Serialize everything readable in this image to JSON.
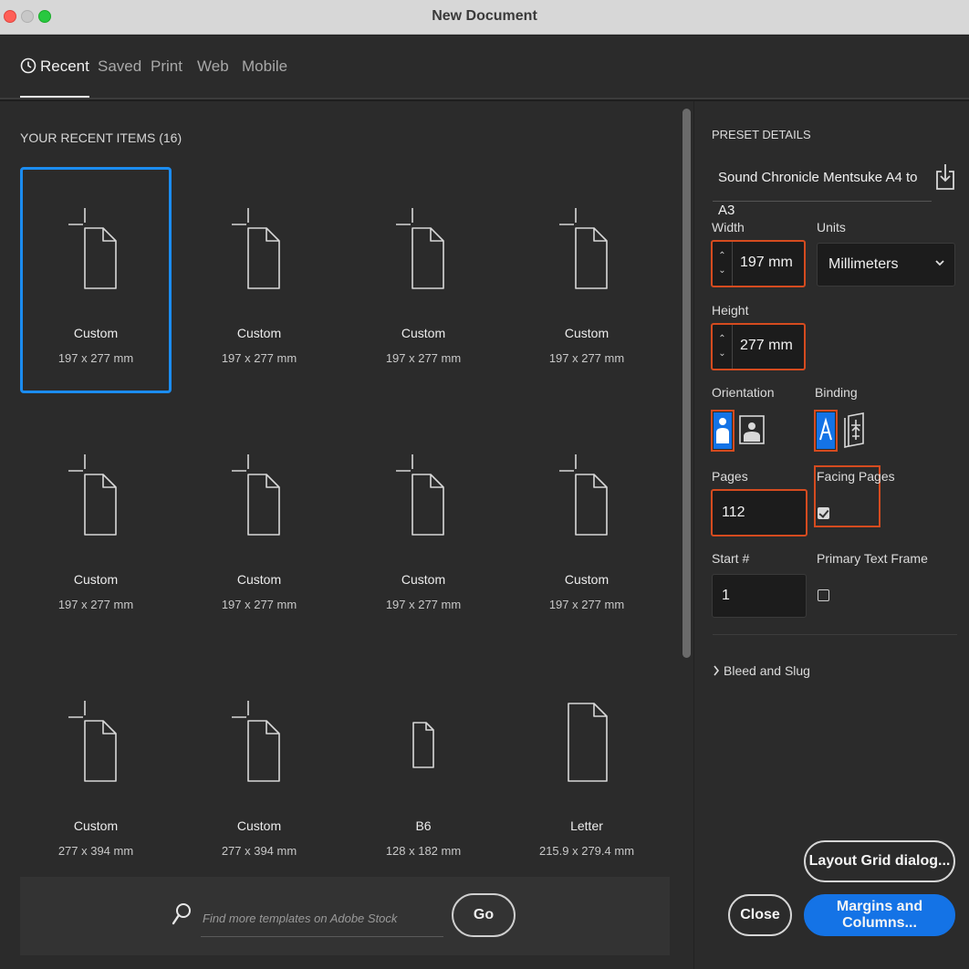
{
  "window": {
    "title": "New Document"
  },
  "tabs": [
    {
      "label": "Recent"
    },
    {
      "label": "Saved"
    },
    {
      "label": "Print"
    },
    {
      "label": "Web"
    },
    {
      "label": "Mobile"
    }
  ],
  "recent": {
    "title": "YOUR RECENT ITEMS",
    "count": "(16)",
    "items": [
      {
        "name": "Custom",
        "size": "197 x 277 mm"
      },
      {
        "name": "Custom",
        "size": "197 x 277 mm"
      },
      {
        "name": "Custom",
        "size": "197 x 277 mm"
      },
      {
        "name": "Custom",
        "size": "197 x 277 mm"
      },
      {
        "name": "Custom",
        "size": "197 x 277 mm"
      },
      {
        "name": "Custom",
        "size": "197 x 277 mm"
      },
      {
        "name": "Custom",
        "size": "197 x 277 mm"
      },
      {
        "name": "Custom",
        "size": "197 x 277 mm"
      },
      {
        "name": "Custom",
        "size": "277 x 394 mm"
      },
      {
        "name": "Custom",
        "size": "277 x 394 mm"
      },
      {
        "name": "B6",
        "size": "128 x 182 mm"
      },
      {
        "name": "Letter",
        "size": "215.9 x 279.4 mm"
      }
    ]
  },
  "stock": {
    "placeholder": "Find more templates on Adobe Stock",
    "go_label": "Go"
  },
  "preset": {
    "section_title": "PRESET DETAILS",
    "name": "Sound Chronicle Mentsuke A4 to A3",
    "width_label": "Width",
    "width_value": "197 mm",
    "units_label": "Units",
    "units_value": "Millimeters",
    "height_label": "Height",
    "height_value": "277 mm",
    "orientation_label": "Orientation",
    "binding_label": "Binding",
    "pages_label": "Pages",
    "pages_value": "112",
    "facing_label": "Facing Pages",
    "start_label": "Start #",
    "start_value": "1",
    "primary_frame_label": "Primary Text Frame",
    "bleed_label": "Bleed and Slug"
  },
  "buttons": {
    "layout_grid": "Layout Grid dialog...",
    "close": "Close",
    "margins": "Margins and Columns..."
  },
  "colors": {
    "accent": "#1473e6",
    "highlight": "#d54b1f",
    "selection": "#1b8cf0"
  }
}
